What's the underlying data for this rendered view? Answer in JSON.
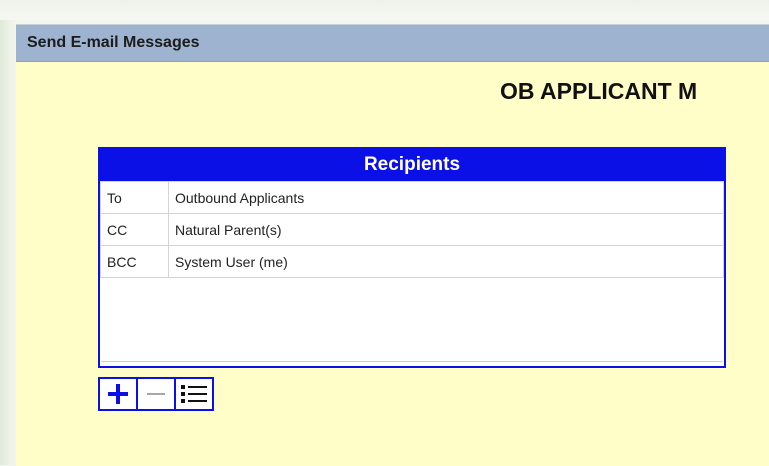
{
  "panel": {
    "title": "Send E-mail Messages",
    "heading": "OB APPLICANT M"
  },
  "recipients": {
    "header": "Recipients",
    "rows": [
      {
        "type": "To",
        "name": "Outbound Applicants"
      },
      {
        "type": "CC",
        "name": "Natural Parent(s)"
      },
      {
        "type": "BCC",
        "name": "System User (me)"
      }
    ]
  },
  "toolbar": {
    "add_icon": "plus-icon",
    "remove_icon": "minus-icon",
    "list_icon": "list-icon"
  },
  "colors": {
    "accent": "#0a10e6",
    "panel_bg": "#fffdc8",
    "header_bg": "#9db3cf"
  }
}
